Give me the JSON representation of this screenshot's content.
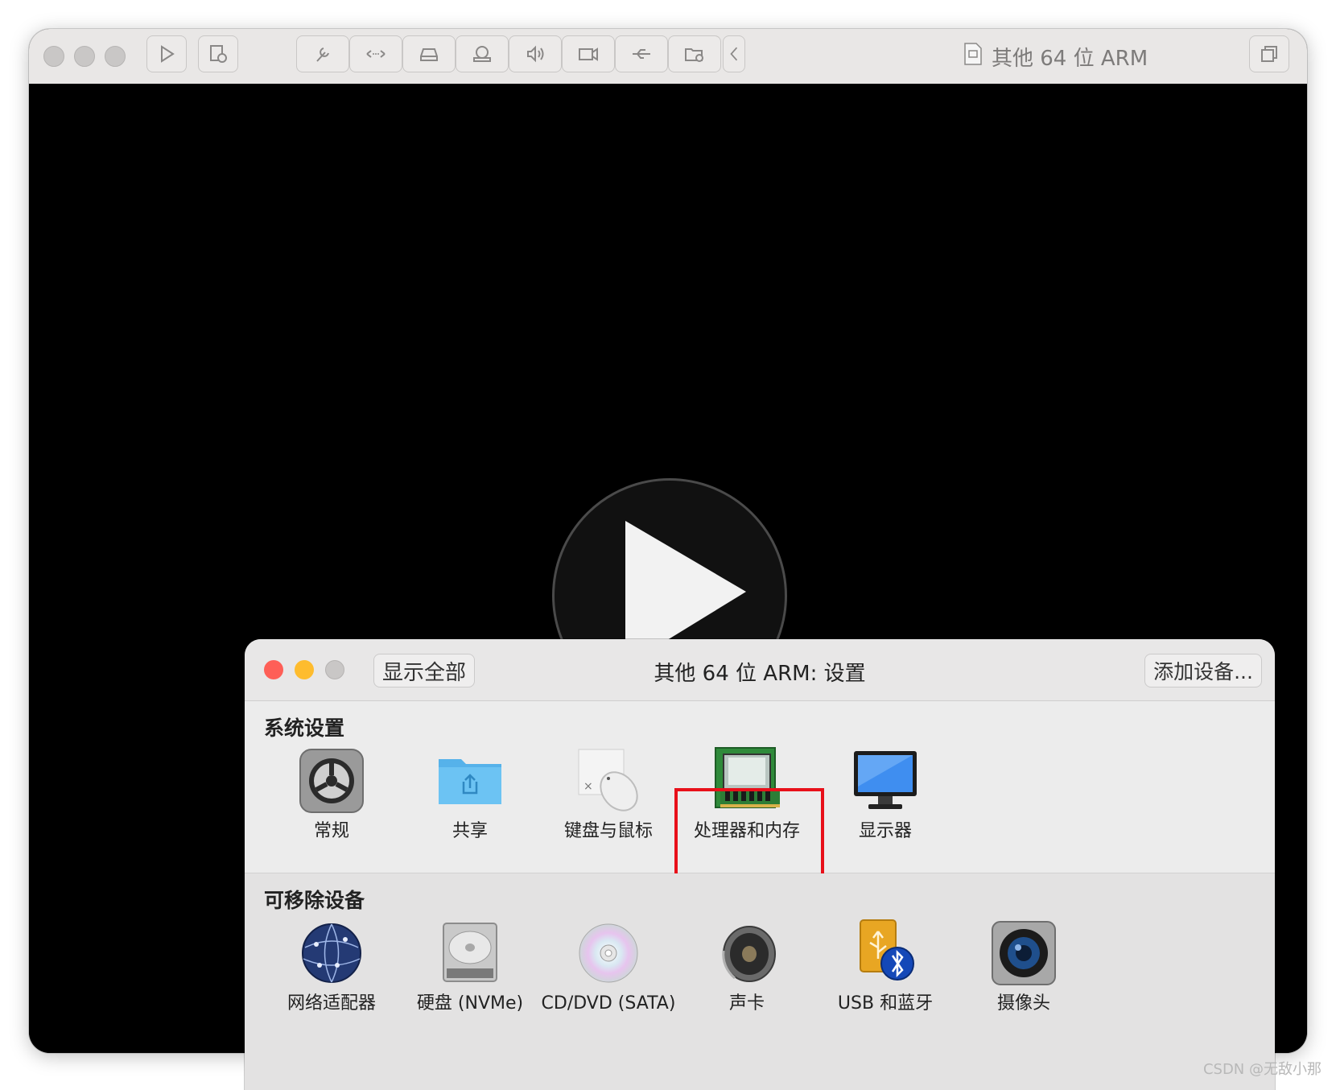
{
  "window": {
    "title": "其他 64 位 ARM"
  },
  "toolbar": {
    "buttons": [
      {
        "name": "play-icon"
      },
      {
        "name": "snapshot-icon"
      },
      {
        "name": "wrench-icon"
      },
      {
        "name": "network-arrows-icon"
      },
      {
        "name": "hard-disk-icon"
      },
      {
        "name": "optical-drive-icon"
      },
      {
        "name": "speaker-icon"
      },
      {
        "name": "camera-icon"
      },
      {
        "name": "usb-icon"
      },
      {
        "name": "shared-folder-icon"
      },
      {
        "name": "chevron-left-icon"
      },
      {
        "name": "window-switch-icon"
      }
    ]
  },
  "settings": {
    "title": "其他 64 位 ARM: 设置",
    "show_all": "显示全部",
    "add_device": "添加设备...",
    "system_section_title": "系统设置",
    "system_items": [
      {
        "label": "常规",
        "icon": "general-gear-icon"
      },
      {
        "label": "共享",
        "icon": "shared-folder-icon"
      },
      {
        "label": "键盘与鼠标",
        "icon": "keyboard-mouse-icon"
      },
      {
        "label": "处理器和内存",
        "icon": "processor-memory-icon"
      },
      {
        "label": "显示器",
        "icon": "display-icon"
      }
    ],
    "removable_section_title": "可移除设备",
    "removable_items": [
      {
        "label": "网络适配器",
        "icon": "network-globe-icon"
      },
      {
        "label": "硬盘 (NVMe)",
        "icon": "hard-disk-icon"
      },
      {
        "label": "CD/DVD (SATA)",
        "icon": "cd-dvd-icon"
      },
      {
        "label": "声卡",
        "icon": "sound-card-icon"
      },
      {
        "label": "USB 和蓝牙",
        "icon": "usb-bluetooth-icon"
      },
      {
        "label": "摄像头",
        "icon": "camera-icon"
      }
    ],
    "highlighted_item": "处理器和内存"
  },
  "colors": {
    "highlight_border": "#e8101a",
    "close": "#fe5f57",
    "minimize": "#febc2e"
  },
  "watermark": "CSDN @无敌小那"
}
